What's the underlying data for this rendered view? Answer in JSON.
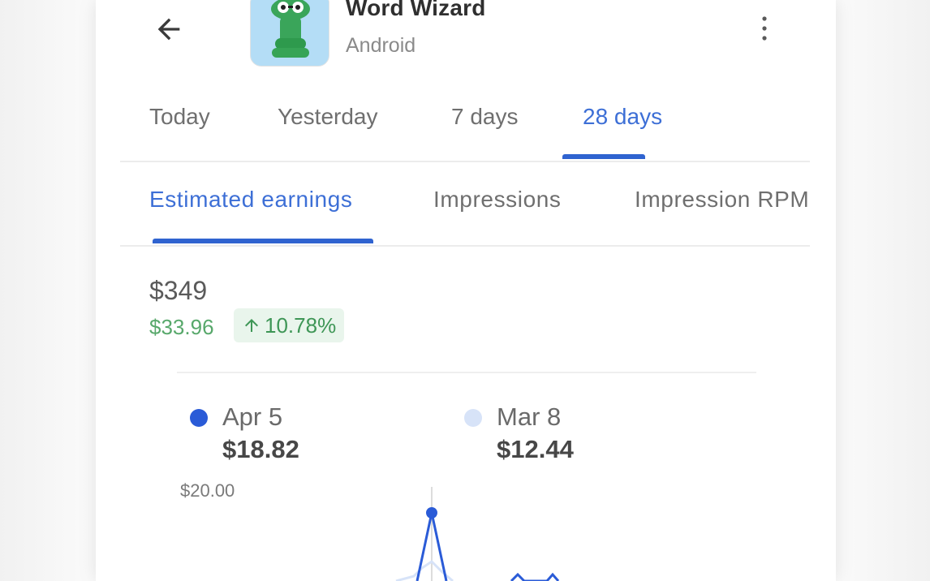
{
  "header": {
    "back_icon": "arrow-back-icon",
    "app_name": "Word Wizard",
    "platform": "Android",
    "app_icon": "word-wizard-app-icon",
    "more_icon": "more-vert-icon"
  },
  "period_tabs": [
    {
      "label": "Today",
      "active": false
    },
    {
      "label": "Yesterday",
      "active": false
    },
    {
      "label": "7 days",
      "active": false
    },
    {
      "label": "28 days",
      "active": true
    }
  ],
  "metric_tabs": [
    {
      "label": "Estimated earnings",
      "active": true
    },
    {
      "label": "Impressions",
      "active": false
    },
    {
      "label": "Impression RPM",
      "active": false
    }
  ],
  "summary": {
    "total": "$349",
    "change_amount": "$33.96",
    "change_percent": "10.78%",
    "change_icon": "arrow-up-icon"
  },
  "legend": [
    {
      "date": "Apr 5",
      "value": "$18.82",
      "color": "#2a5bd7"
    },
    {
      "date": "Mar 8",
      "value": "$12.44",
      "color": "#d7e3f8"
    }
  ],
  "colors": {
    "accent": "#2f63d0",
    "positive": "#58a86b",
    "positive_bg": "#e9f5ec"
  },
  "chart_data": {
    "type": "line",
    "y_tick_labels": [
      "$20.00"
    ],
    "highlighted_point": {
      "x": "Apr 5",
      "y": 18.82
    }
  }
}
